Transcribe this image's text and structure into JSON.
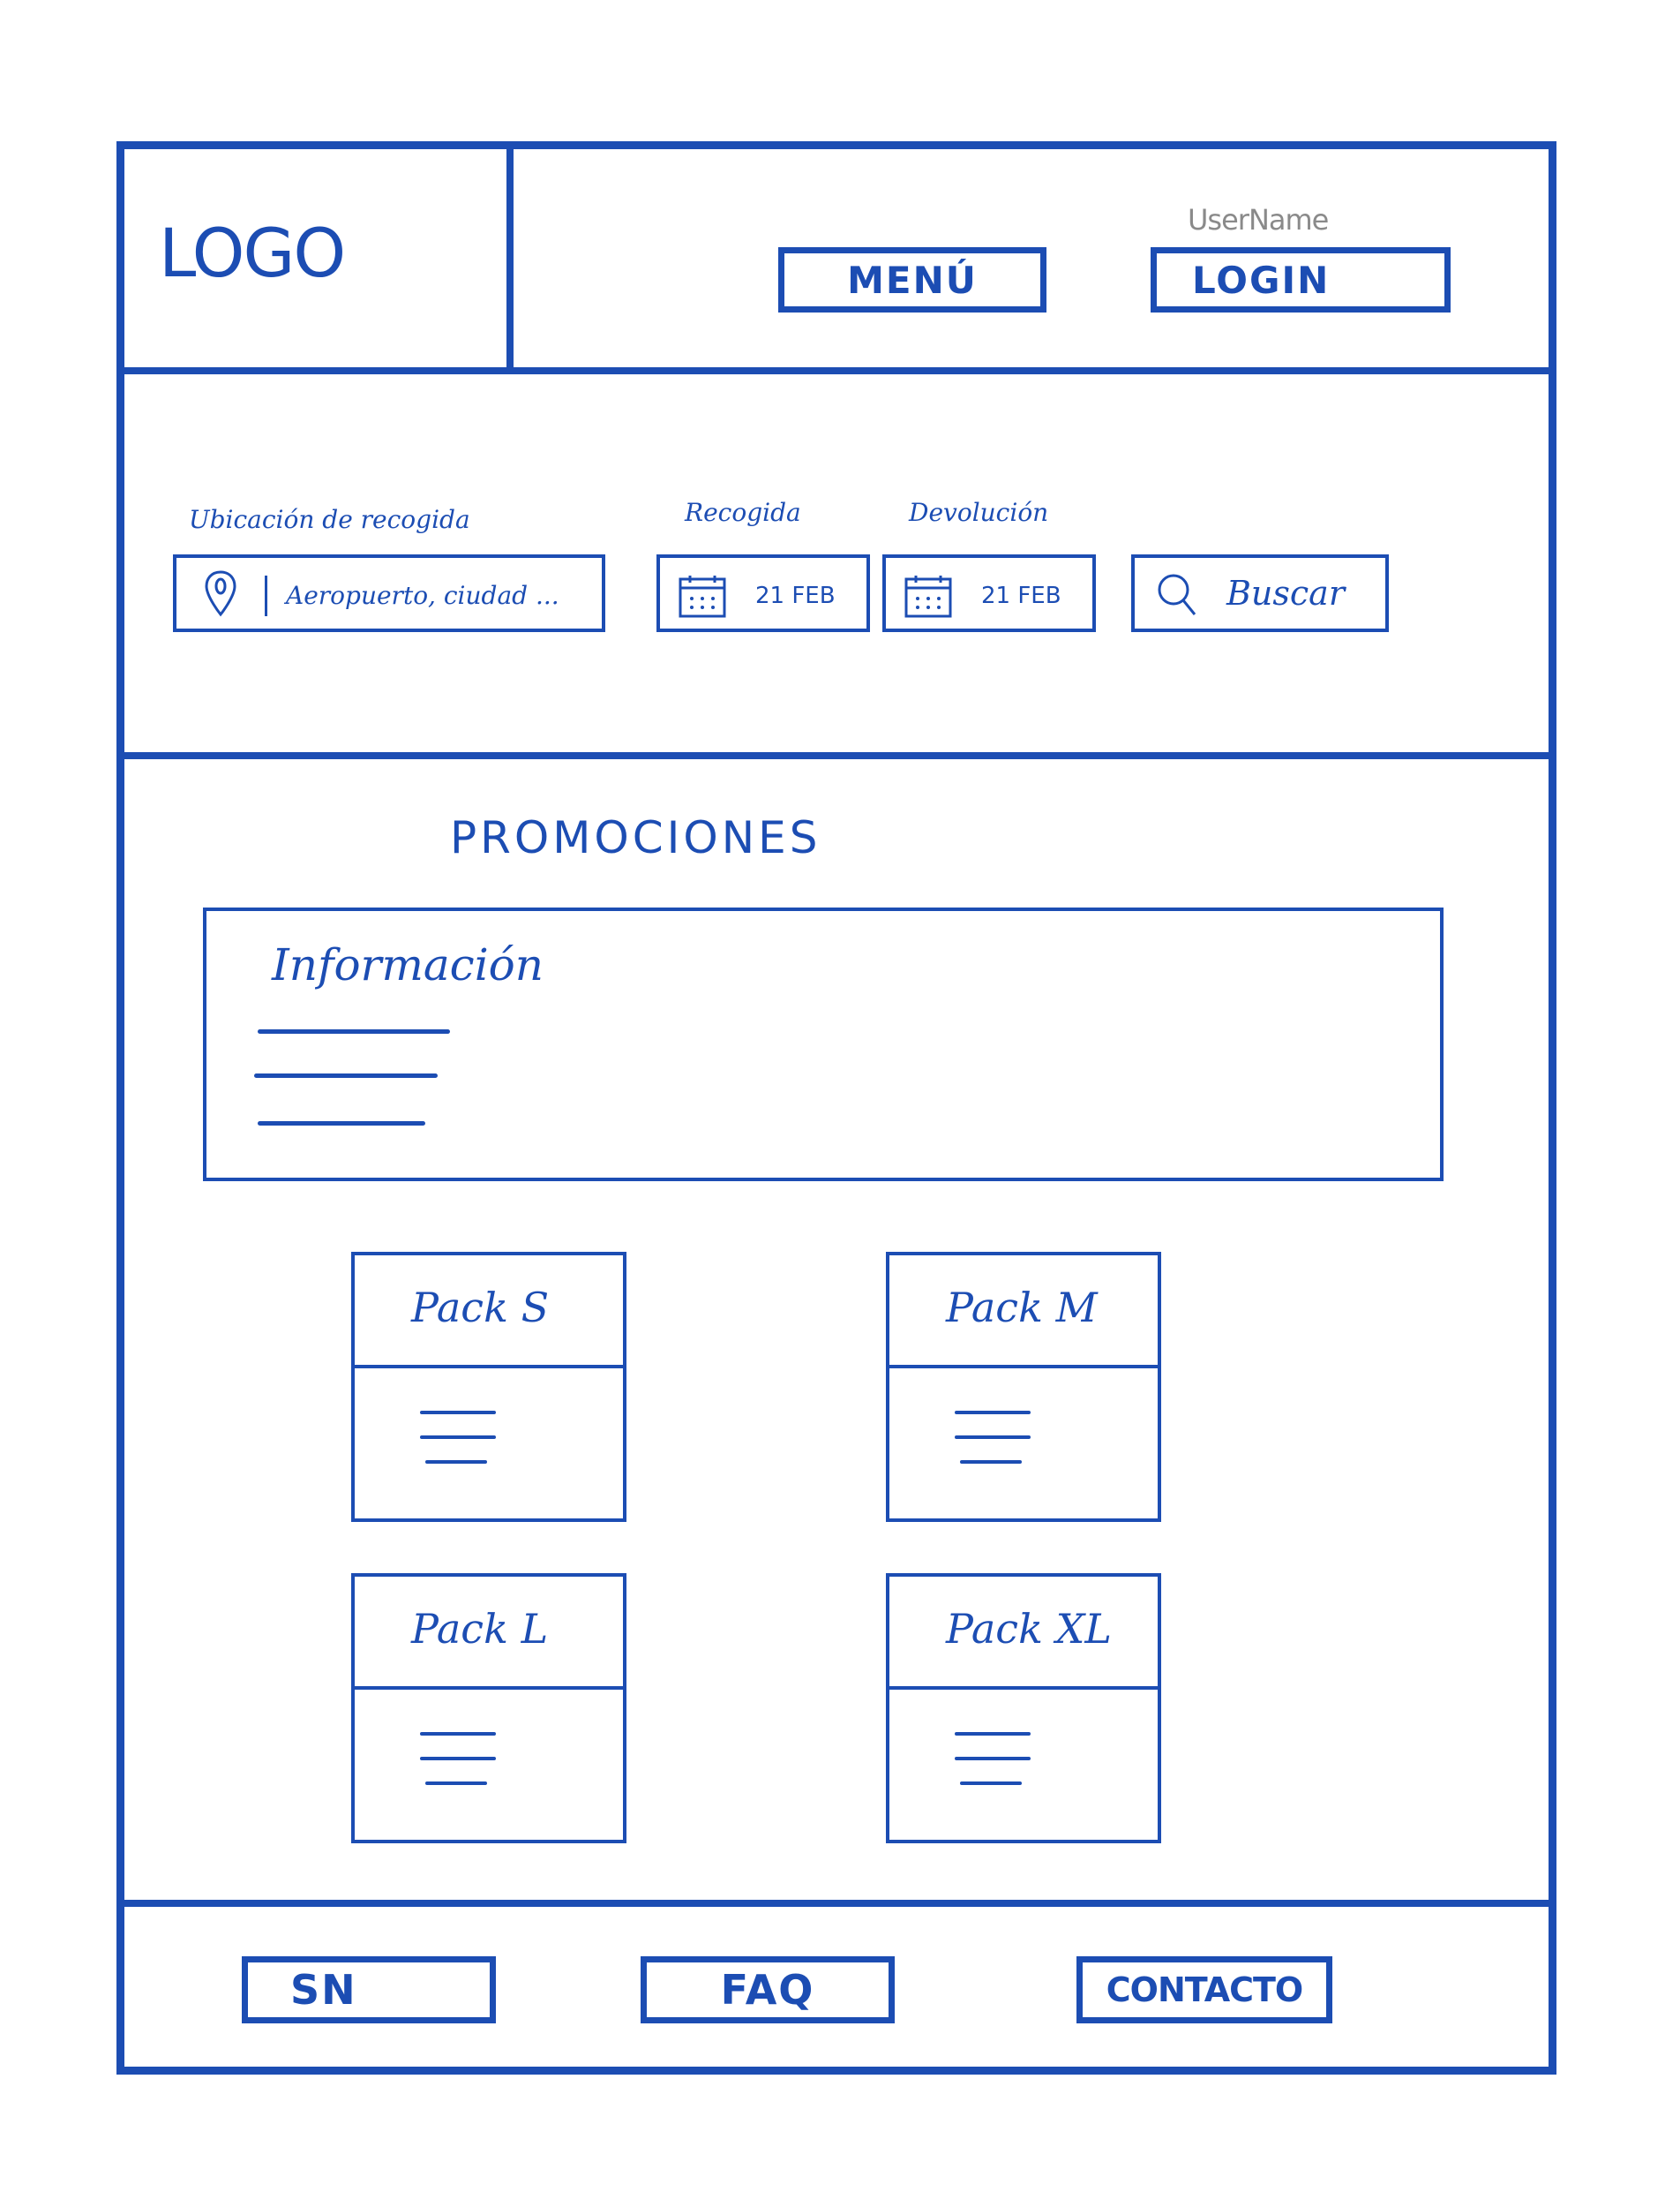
{
  "header": {
    "logo": "LOGO",
    "username": "UserName",
    "menu_label": "MENÚ",
    "login_label": "LOGIN"
  },
  "search": {
    "location_label": "Ubicación de recogida",
    "location_placeholder": "Aeropuerto, ciudad ...",
    "pickup_label": "Recogida",
    "pickup_date": "21 FEB",
    "return_label": "Devolución",
    "return_date": "21 FEB",
    "search_button": "Buscar"
  },
  "promotions": {
    "title": "PROMOCIONES",
    "info_title": "Información",
    "packs": [
      {
        "name": "Pack S"
      },
      {
        "name": "Pack M"
      },
      {
        "name": "Pack L"
      },
      {
        "name": "Pack XL"
      }
    ]
  },
  "footer": {
    "sn": "SN",
    "faq": "FAQ",
    "contact": "CONTACTO"
  },
  "colors": {
    "ink": "#1c4db3",
    "username_gray": "#8a8a8a"
  },
  "icons": [
    "location-pin-icon",
    "calendar-icon",
    "search-icon"
  ]
}
